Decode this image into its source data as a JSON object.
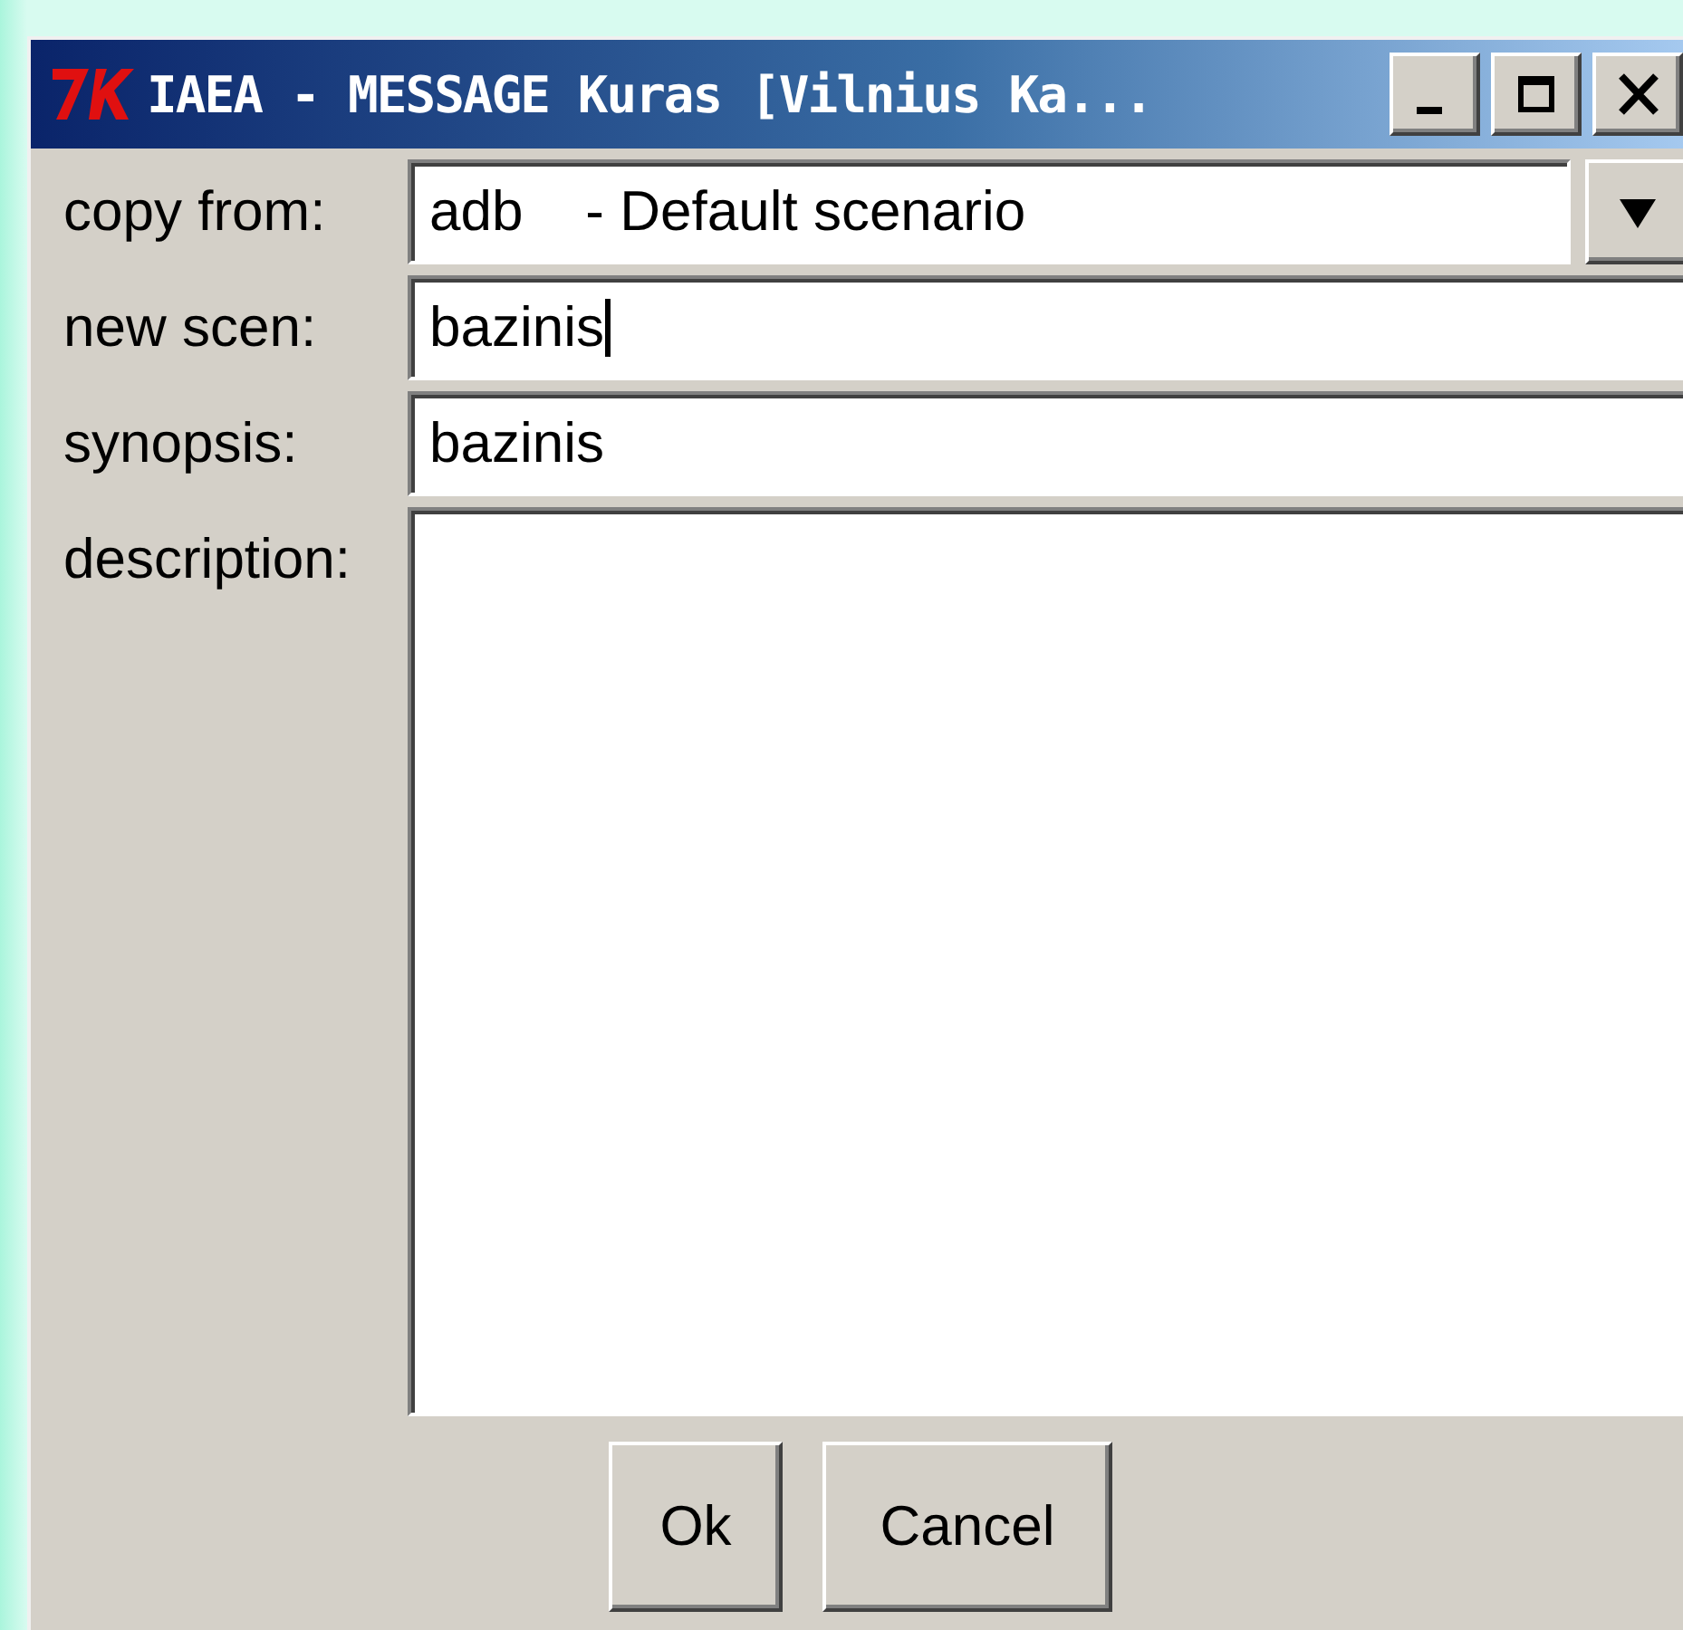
{
  "window": {
    "title": "IAEA - MESSAGE Kuras [Vilnius Ka..."
  },
  "fields": [
    {
      "kind": "dropdown",
      "label": "copy from:",
      "value": "adb    - Default scenario"
    },
    {
      "kind": "entry",
      "label": "new scen:",
      "value": "bazinis",
      "focused": true
    },
    {
      "kind": "entry",
      "label": "synopsis:",
      "value": "bazinis",
      "focused": false
    },
    {
      "kind": "text",
      "label": "description:"
    }
  ],
  "buttons": [
    "Ok",
    "Cancel"
  ]
}
